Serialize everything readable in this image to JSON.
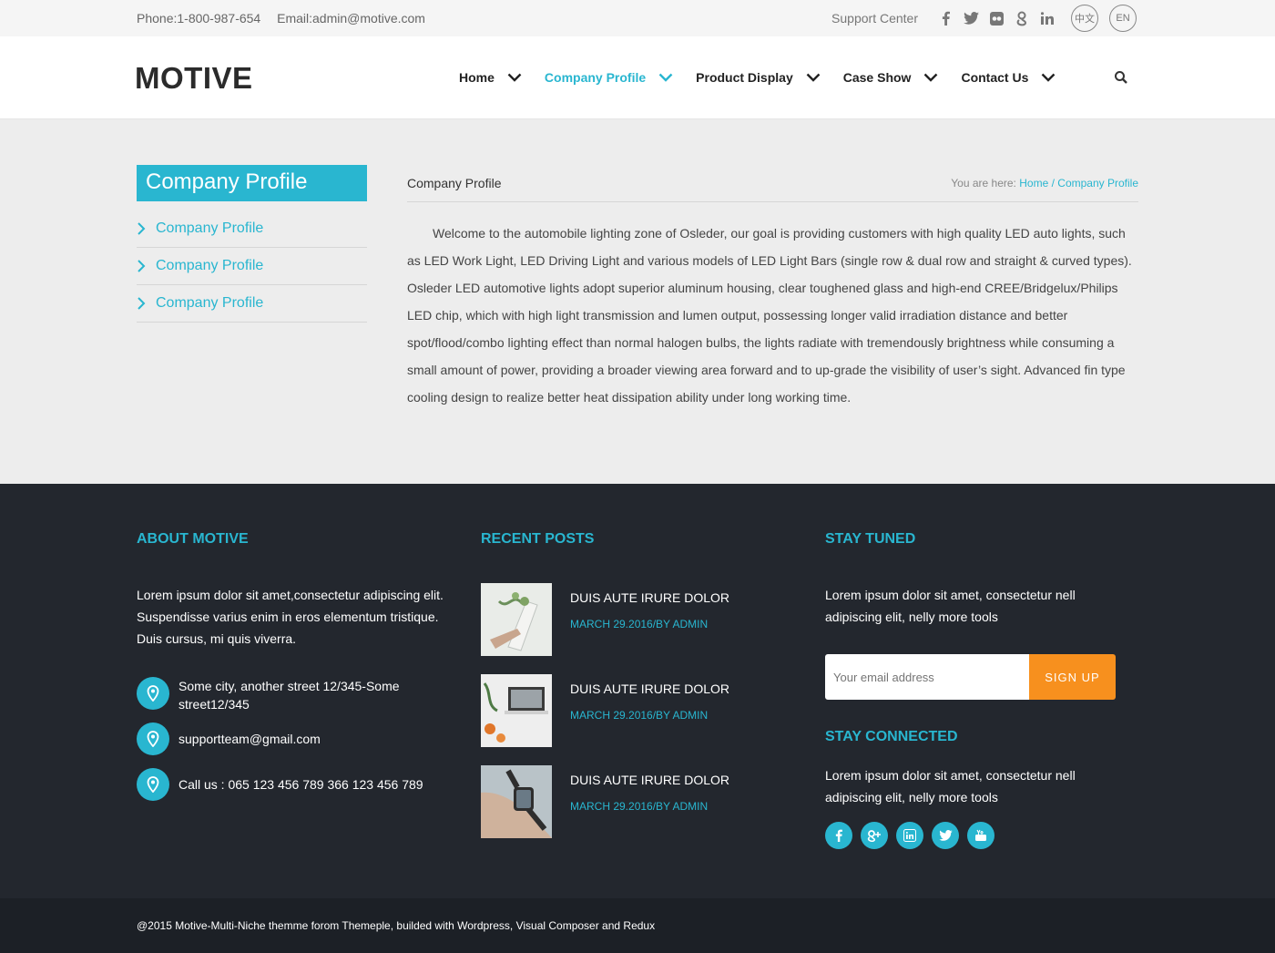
{
  "topbar": {
    "phone": "Phone:1-800-987-654",
    "email": "Email:admin@motive.com",
    "support": "Support Center",
    "social_icons": [
      "facebook-icon",
      "twitter-icon",
      "flickr-icon",
      "google-plus-icon",
      "linkedin-icon"
    ],
    "lang_cn": "中文",
    "lang_en": "EN"
  },
  "header": {
    "logo": "MOTIVE",
    "nav": [
      {
        "label": "Home",
        "active": false
      },
      {
        "label": "Company Profile",
        "active": true
      },
      {
        "label": "Product Display",
        "active": false
      },
      {
        "label": "Case Show",
        "active": false
      },
      {
        "label": "Contact Us",
        "active": false
      }
    ]
  },
  "sidebar": {
    "title": "Company Profile",
    "items": [
      {
        "label": "Company Profile"
      },
      {
        "label": "Company Profile"
      },
      {
        "label": "Company Profile"
      }
    ]
  },
  "content": {
    "title": "Company Profile",
    "breadcrumb_prefix": "You are here:",
    "breadcrumb_home": "Home",
    "breadcrumb_sep": "/",
    "breadcrumb_current": "Company Profile",
    "body": "Welcome to the automobile lighting zone of Osleder, our goal is providing customers with high quality LED auto lights, such as LED Work Light, LED Driving Light and various models of LED Light Bars (single row & dual row and straight & curved types). Osleder LED automotive lights adopt superior aluminum housing, clear toughened glass and high-end CREE/Bridgelux/Philips LED chip, which with high light transmission and lumen output, possessing longer valid irradiation distance and better spot/flood/combo lighting effect than normal halogen bulbs, the lights radiate with tremendously brightness while consuming a small amount of power, providing a broader viewing area forward and to up-grade the visibility of user’s sight. Advanced fin type cooling design to realize better heat dissipation ability under long working time."
  },
  "footer": {
    "about_title": "ABOUT MOTIVE",
    "about_text": "Lorem ipsum dolor sit amet,consectetur adipiscing elit. Suspendisse varius enim in eros elementum tristique. Duis cursus, mi quis viverra.",
    "address": "Some city, another street 12/345-Some street12/345",
    "email": "supportteam@gmail.com",
    "phone": "Call us : 065 123 456 789 366 123 456 789",
    "posts_title": "RECENT POSTS",
    "posts": [
      {
        "title": "DUIS AUTE IRURE DOLOR",
        "date": "MARCH 29.2016/BY ADMIN"
      },
      {
        "title": "DUIS AUTE IRURE DOLOR",
        "date": "MARCH 29.2016/BY ADMIN"
      },
      {
        "title": "DUIS AUTE IRURE DOLOR",
        "date": "MARCH 29.2016/BY ADMIN"
      }
    ],
    "tuned_title": "STAY TUNED",
    "tuned_text": "Lorem ipsum dolor sit amet, consectetur nell adipiscing elit, nelly more tools",
    "email_placeholder": "Your email address",
    "signup": "SIGN UP",
    "connected_title": "STAY CONNECTED",
    "connected_text": "Lorem ipsum dolor sit amet, consectetur nell adipiscing elit, nelly more tools",
    "social_icons": [
      "facebook-icon",
      "google-plus-icon",
      "linkedin-icon",
      "twitter-icon",
      "youtube-icon"
    ],
    "copyright": "@2015 Motive-Multi-Niche themme forom Themeple, builded with Wordpress, Visual Composer and Redux"
  },
  "colors": {
    "accent": "#29b6d0",
    "orange": "#f7901e",
    "footer_bg": "#23272e"
  }
}
